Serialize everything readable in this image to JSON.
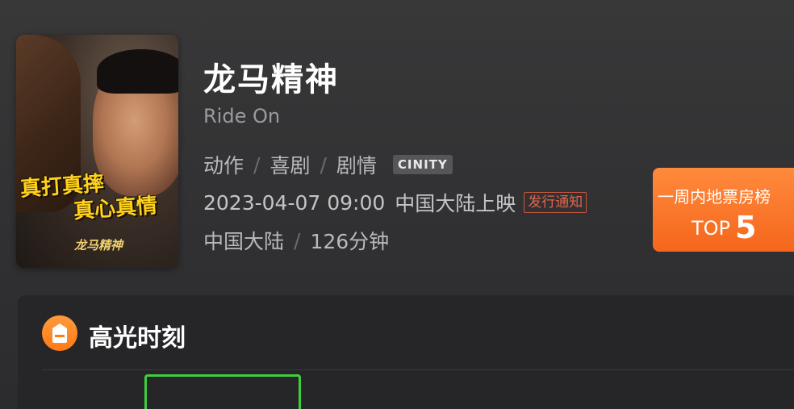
{
  "movie": {
    "title": "龙马精神",
    "original_title": "Ride On",
    "genres": [
      "动作",
      "喜剧",
      "剧情"
    ],
    "genre_separator": "/",
    "format_badge": "CINITY",
    "release_datetime": "2023-04-07 09:00",
    "release_region": "中国大陆上映",
    "release_notice": "发行通知",
    "country": "中国大陆",
    "duration": "126分钟"
  },
  "poster": {
    "tagline_line1": "真打真摔",
    "tagline_line2": "真心真情",
    "logo_text": "龙马精神"
  },
  "box_office": {
    "label": "一周内地票房榜",
    "rank_prefix": "TOP",
    "rank_value": "5",
    "color": "#f5661c"
  },
  "highlights": {
    "title": "高光时刻",
    "icon": "tag-icon",
    "partial_text": ""
  }
}
